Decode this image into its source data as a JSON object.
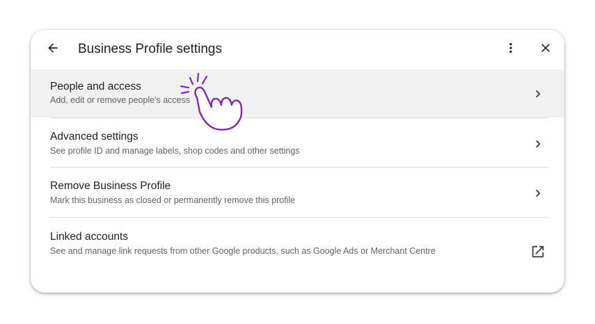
{
  "header": {
    "title": "Business Profile settings",
    "back_icon": "arrow-left-icon",
    "more_icon": "more-vert-icon",
    "close_icon": "close-icon"
  },
  "items": [
    {
      "title": "People and access",
      "subtitle": "Add, edit or remove people's access",
      "action_icon": "chevron-right-icon",
      "highlighted": true
    },
    {
      "title": "Advanced settings",
      "subtitle": "See profile ID and manage labels, shop codes and other settings",
      "action_icon": "chevron-right-icon"
    },
    {
      "title": "Remove Business Profile",
      "subtitle": "Mark this business as closed or permanently remove this profile",
      "action_icon": "chevron-right-icon"
    },
    {
      "title": "Linked accounts",
      "subtitle": "See and manage link requests from other Google products, such as Google Ads or Merchant Centre",
      "action_icon": "open-in-new-icon"
    }
  ],
  "overlay": {
    "pointer_icon": "pointing-hand-icon"
  },
  "colors": {
    "highlight_bg": "#f1f1f1",
    "text_primary": "#202124",
    "text_secondary": "#5f6368",
    "divider": "#dadce0",
    "hand_accent": "#7b2ab0"
  }
}
